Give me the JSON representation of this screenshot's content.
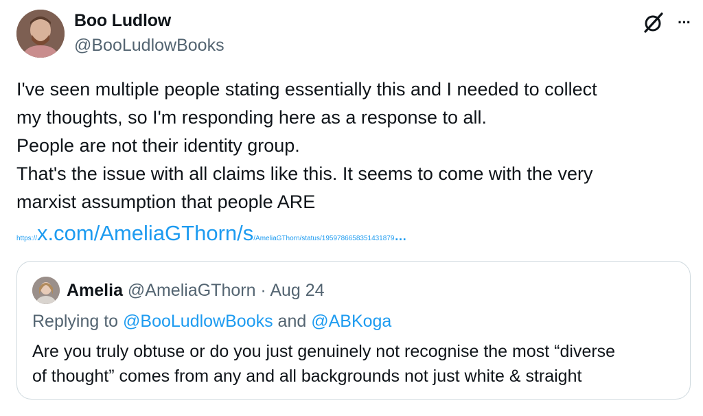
{
  "tweet": {
    "author": {
      "name": "Boo Ludlow",
      "handle": "@BooLudlowBooks",
      "avatar_icon": "person-avatar"
    },
    "icons": {
      "grok": "grok-icon",
      "more": "more-options-icon",
      "more_glyph": "···"
    },
    "text_lines": [
      "I've seen multiple people stating essentially this and I needed to collect",
      "my thoughts, so I'm responding here as a response to all.",
      "People are not their identity group.",
      "That's the issue with all claims like this. It seems to come with the very",
      "marxist assumption that people ARE"
    ],
    "link": {
      "prefix": "https://",
      "main": "x.com/AmeliaGThorn/s",
      "suffix": "/AmeliaGThorn/status/1959786658351431879",
      "ellipsis": "…"
    }
  },
  "quote": {
    "author_name": "Amelia",
    "meta": " @AmeliaGThorn · Aug 24",
    "reply_prefix": "Replying to ",
    "reply_mention_1": "@BooLudlowBooks",
    "reply_and": " and ",
    "reply_mention_2": "@ABKoga",
    "text_lines": [
      "Are you truly obtuse or do you just genuinely not recognise the most “diverse",
      "of thought” comes from any and all backgrounds not just white & straight"
    ]
  },
  "colors": {
    "link": "#1d9bf0",
    "secondary_text": "#536471",
    "border": "#cfd9de"
  }
}
